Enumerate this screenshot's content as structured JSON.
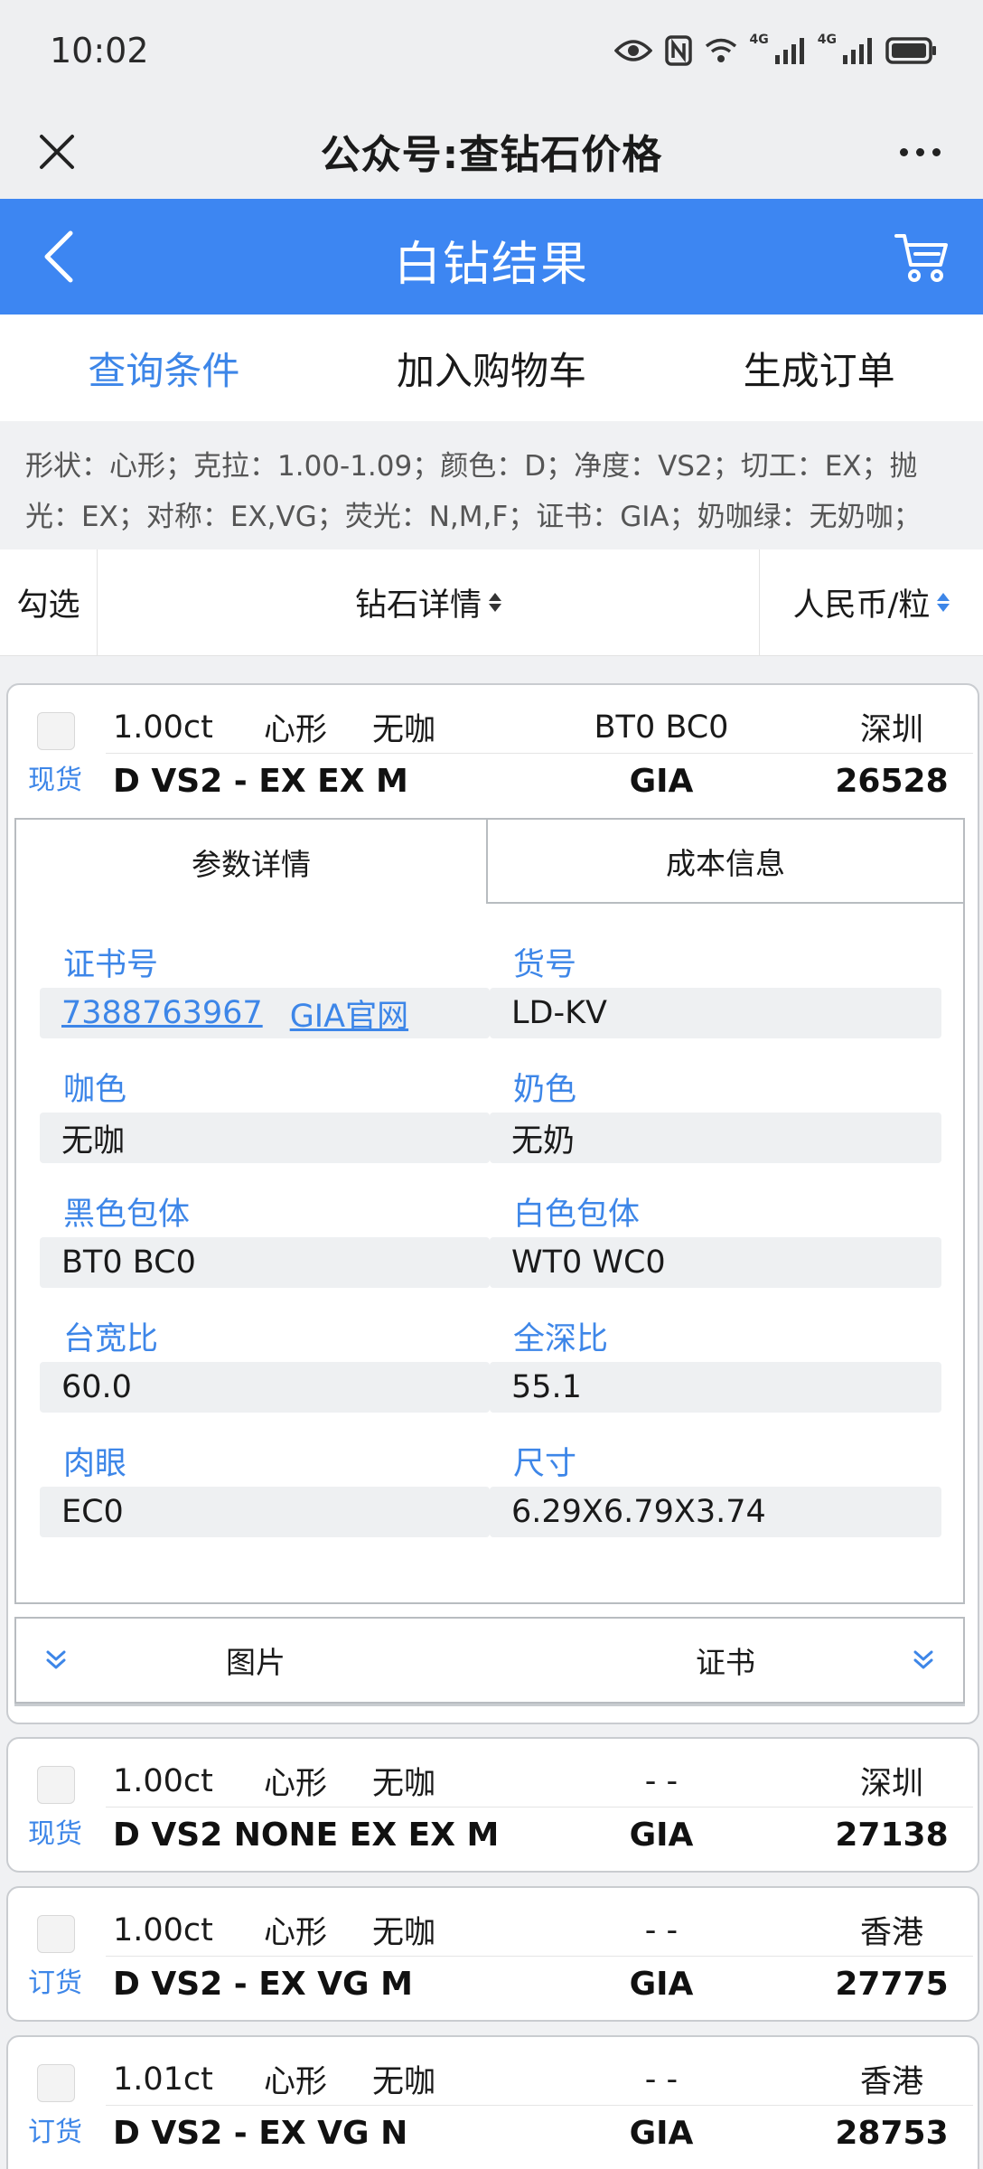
{
  "status_bar": {
    "time": "10:02",
    "icons": [
      "eye-icon",
      "nfc-icon",
      "wifi-icon",
      "signal-4g-icon",
      "signal-4g-icon",
      "battery-icon"
    ],
    "network_labels": [
      "4G",
      "4G"
    ]
  },
  "app_bar": {
    "title": "公众号:查钻石价格",
    "close_icon": "close-icon",
    "more_icon": "more-icon"
  },
  "header": {
    "title": "白钻结果",
    "back_icon": "chevron-left-icon",
    "cart_icon": "cart-icon",
    "color": "#3d86f2"
  },
  "actions": [
    {
      "label": "查询条件",
      "active": true
    },
    {
      "label": "加入购物车",
      "active": false
    },
    {
      "label": "生成订单",
      "active": false
    }
  ],
  "filters": {
    "line1": "形状：心形；克拉：1.00-1.09；颜色：D；净度：VS2；切工：EX；抛",
    "line2": "光：EX；对称：EX,VG；荧光：N,M,F；证书：GIA；奶咖绿：无奶咖；"
  },
  "table_header": {
    "check": "勾选",
    "detail": "钻石详情",
    "price": "人民币/粒"
  },
  "diamonds": [
    {
      "status": "现货",
      "carat": "1.00ct",
      "shape": "心形",
      "tint": "无咖",
      "inclusion": "BT0 BC0",
      "location": "深圳",
      "grade": "D VS2 - EX EX M",
      "lab": "GIA",
      "price": "26528"
    },
    {
      "status": "现货",
      "carat": "1.00ct",
      "shape": "心形",
      "tint": "无咖",
      "inclusion": "- -",
      "location": "深圳",
      "grade": "D VS2 NONE EX EX M",
      "lab": "GIA",
      "price": "27138"
    },
    {
      "status": "订货",
      "carat": "1.00ct",
      "shape": "心形",
      "tint": "无咖",
      "inclusion": "- -",
      "location": "香港",
      "grade": "D VS2 - EX VG M",
      "lab": "GIA",
      "price": "27775"
    },
    {
      "status": "订货",
      "carat": "1.01ct",
      "shape": "心形",
      "tint": "无咖",
      "inclusion": "- -",
      "location": "香港",
      "grade": "D VS2 - EX VG N",
      "lab": "GIA",
      "price": "28753"
    }
  ],
  "detail": {
    "tabs": [
      "参数详情",
      "成本信息"
    ],
    "params": {
      "cert_no_label": "证书号",
      "cert_no": "7388763967",
      "gia_link": "GIA官网",
      "stock_no_label": "货号",
      "stock_no": "LD-KV",
      "brown_label": "咖色",
      "brown": "无咖",
      "milky_label": "奶色",
      "milky": "无奶",
      "black_inc_label": "黑色包体",
      "black_inc": "BT0 BC0",
      "white_inc_label": "白色包体",
      "white_inc": "WT0 WC0",
      "table_label": "台宽比",
      "table": "60.0",
      "depth_label": "全深比",
      "depth": "55.1",
      "eye_clean_label": "肉眼",
      "eye_clean": "EC0",
      "size_label": "尺寸",
      "size": "6.29X6.79X3.74"
    },
    "media": {
      "images": "图片",
      "certificate": "证书"
    }
  },
  "colors": {
    "accent": "#3d86e8",
    "header_bg": "#3d86f2",
    "page_bg": "#f0f1f3"
  }
}
